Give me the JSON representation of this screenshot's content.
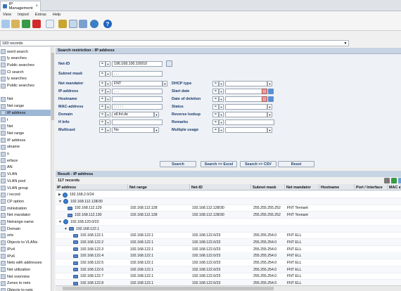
{
  "window": {
    "tab_title": "IP Management"
  },
  "menu": [
    "View",
    "Import",
    "Extras",
    "Help"
  ],
  "records_bar": {
    "text": "183 records"
  },
  "sidebar": {
    "items": [
      {
        "label": "word search"
      },
      {
        "label": "ly searches"
      },
      {
        "label": "Public searches"
      },
      {
        "label": "CI search"
      },
      {
        "label": "ly searches"
      },
      {
        "label": "Public searches"
      },
      {
        "label": ""
      },
      {
        "label": "Net"
      },
      {
        "label": "Net range"
      },
      {
        "label": "IP address",
        "selected": true
      },
      {
        "label": "t"
      },
      {
        "label": "Net"
      },
      {
        "label": "Net range"
      },
      {
        "label": "IP address"
      },
      {
        "label": "stname"
      },
      {
        "label": "s"
      },
      {
        "label": "erface"
      },
      {
        "label": "AN"
      },
      {
        "label": "VLAN"
      },
      {
        "label": "VLAN pool"
      },
      {
        "label": "VLAN group"
      },
      {
        "label": "/ record"
      },
      {
        "label": "CP option"
      },
      {
        "label": "ministration"
      },
      {
        "label": "Net mandator"
      },
      {
        "label": "Netrange name"
      },
      {
        "label": "Domain"
      },
      {
        "label": "orts"
      },
      {
        "label": "Objects to VLANs"
      },
      {
        "label": "IPv4"
      },
      {
        "label": "IPv6"
      },
      {
        "label": "Nets with addresses"
      },
      {
        "label": "Net utilization"
      },
      {
        "label": "Net overview"
      },
      {
        "label": "Zones to nets"
      },
      {
        "label": "Objects to nets"
      }
    ]
  },
  "search": {
    "title": "Search restriction - IP address",
    "fields": {
      "net_id": {
        "label": "Net-ID",
        "op": "=",
        "value": "196.168.100.100/10"
      },
      "subnet_mask": {
        "label": "Subnet mask",
        "op": "=",
        "value": ". . ."
      },
      "net_mandator": {
        "label": "Net mandator",
        "op": "=",
        "value": "FNT"
      },
      "ip_address": {
        "label": "IP-address",
        "op": "=",
        "value": ". . ."
      },
      "hostname": {
        "label": "Hostname",
        "op": "=",
        "value": ""
      },
      "mac_address": {
        "label": "MAC-address",
        "op": "=",
        "value": ": : : : :"
      },
      "domain": {
        "label": "Domain",
        "op": "=",
        "value": "ell.fnt.de"
      },
      "h_info": {
        "label": "H Info",
        "op": "=",
        "value": ""
      },
      "multicast": {
        "label": "Multicast",
        "op": "=",
        "value": "No"
      },
      "dhcp_type": {
        "label": "DHCP type",
        "op": "=",
        "value": ""
      },
      "start_date": {
        "label": "Start date",
        "op": "=",
        "value": ""
      },
      "date_of_deletion": {
        "label": "Date of deletion",
        "op": "=",
        "value": ""
      },
      "status": {
        "label": "Status",
        "op": "=",
        "value": ""
      },
      "reverse_lookup": {
        "label": "Reverse lookup",
        "op": "=",
        "value": ""
      },
      "remarks": {
        "label": "Remarks",
        "op": "=",
        "value": ""
      },
      "multiple_usage": {
        "label": "Multiple usage",
        "op": "=",
        "value": ""
      }
    },
    "buttons": {
      "search": "Search",
      "search_excel": "Search >> Excel",
      "search_csv": "Search >> CSV",
      "reset": "Reset"
    }
  },
  "result": {
    "title": "Result - IP address",
    "count": "117 records",
    "columns": [
      "IP address",
      "Net range",
      "Net-ID",
      "Subnet mask",
      "Net mandator",
      "Hostname",
      "Port / Interface",
      "MAC a"
    ],
    "rows": [
      {
        "ip": "192.168.2.0/24",
        "range": "",
        "netid": "",
        "mask": "",
        "mandator": "",
        "level": 0,
        "kind": "net",
        "expanded": false
      },
      {
        "ip": "192.168.112.128/30",
        "range": "",
        "netid": "",
        "mask": "",
        "mandator": "",
        "level": 0,
        "kind": "net",
        "expanded": true
      },
      {
        "ip": "192.168.112.129",
        "range": "192.168.112.128",
        "netid": "192.168.112.128/30",
        "mask": "255.255.255.252",
        "mandator": "FNT Tennant",
        "level": 1,
        "kind": "ip"
      },
      {
        "ip": "192.168.112.130",
        "range": "192.168.112.128",
        "netid": "192.168.112.128/30",
        "mask": "255.255.255.252",
        "mandator": "FNT Tennant",
        "level": 1,
        "kind": "ip"
      },
      {
        "ip": "192.168.120.0/23",
        "range": "",
        "netid": "",
        "mask": "",
        "mandator": "",
        "level": 0,
        "kind": "net",
        "expanded": true
      },
      {
        "ip": "192.168.122.1",
        "range": "",
        "netid": "",
        "mask": "",
        "mandator": "",
        "level": 1,
        "kind": "range",
        "expanded": true
      },
      {
        "ip": "192.168.122.1",
        "range": "192.168.122.1",
        "netid": "192.168.122.0/23",
        "mask": "255.255.254.0",
        "mandator": "FNT ELL",
        "level": 2,
        "kind": "ip"
      },
      {
        "ip": "192.168.122.2",
        "range": "192.168.122.1",
        "netid": "192.168.122.0/23",
        "mask": "255.255.254.0",
        "mandator": "FNT ELL",
        "level": 2,
        "kind": "ip"
      },
      {
        "ip": "192.168.122.3",
        "range": "192.168.122.1",
        "netid": "192.168.122.0/23",
        "mask": "255.255.254.0",
        "mandator": "FNT ELL",
        "level": 2,
        "kind": "ip"
      },
      {
        "ip": "192.168.122.4",
        "range": "192.168.122.1",
        "netid": "192.168.122.0/23",
        "mask": "255.255.254.0",
        "mandator": "FNT ELL",
        "level": 2,
        "kind": "ip"
      },
      {
        "ip": "192.168.122.5",
        "range": "192.168.122.1",
        "netid": "192.168.122.0/23",
        "mask": "255.255.254.0",
        "mandator": "FNT ELL",
        "level": 2,
        "kind": "ip"
      },
      {
        "ip": "192.168.122.6",
        "range": "192.168.122.1",
        "netid": "192.168.122.0/23",
        "mask": "255.255.254.0",
        "mandator": "FNT ELL",
        "level": 2,
        "kind": "ip"
      },
      {
        "ip": "192.168.122.7",
        "range": "192.168.122.1",
        "netid": "192.168.122.0/23",
        "mask": "255.255.254.0",
        "mandator": "FNT ELL",
        "level": 2,
        "kind": "ip"
      },
      {
        "ip": "192.168.122.8",
        "range": "192.168.122.1",
        "netid": "192.168.122.0/23",
        "mask": "255.255.254.0",
        "mandator": "FNT ELL",
        "level": 2,
        "kind": "ip"
      }
    ]
  },
  "colors": {
    "header_blue": "#c7d4e4",
    "label_blue": "#1c3d6e",
    "selection": "#9db7d6"
  }
}
